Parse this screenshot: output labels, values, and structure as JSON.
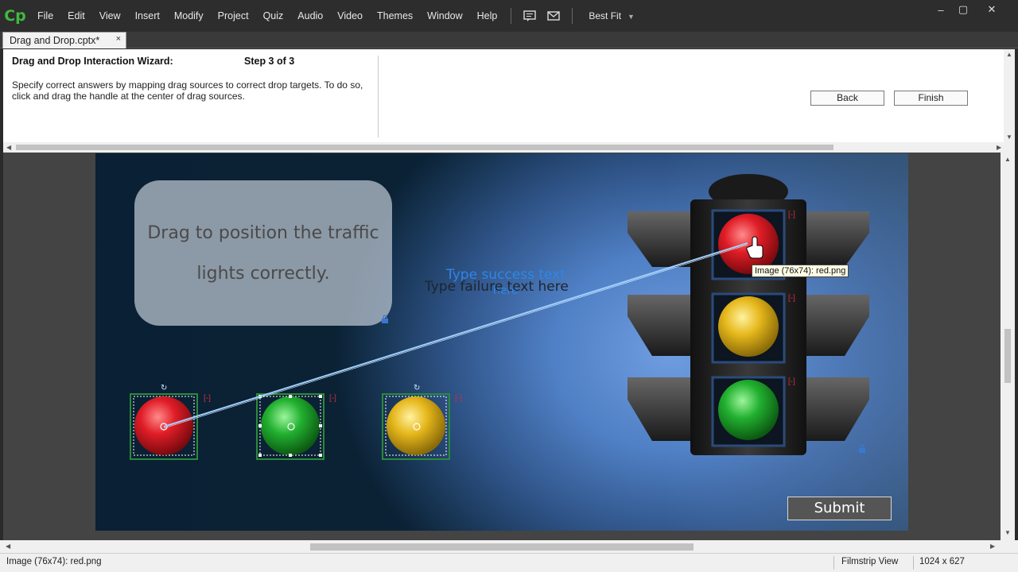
{
  "app": {
    "logo": "Cp"
  },
  "menu": [
    "File",
    "Edit",
    "View",
    "Insert",
    "Modify",
    "Project",
    "Quiz",
    "Audio",
    "Video",
    "Themes",
    "Window",
    "Help"
  ],
  "toolbar": {
    "zoom_label": "Best Fit"
  },
  "window_controls": {
    "minimize": "–",
    "restore": "▢",
    "close": "✕"
  },
  "tab": {
    "label": "Drag and Drop.cptx*",
    "close": "×"
  },
  "wizard": {
    "title": "Drag and Drop Interaction Wizard:",
    "step": "Step  3  of 3",
    "description": "Specify correct answers by mapping drag sources to correct drop targets. To do so, click and drag the handle at the center of drag sources.",
    "back_label": "Back",
    "finish_label": "Finish"
  },
  "stage": {
    "caption": "Drag to position the traffic lights correctly.",
    "success_text": "Type success text",
    "success_text_2": "here",
    "failure_text": "Type failure text here",
    "submit_label": "Submit",
    "tooltip": "Image (76x74): red.png",
    "drag_sources": [
      {
        "name": "red",
        "color": "#d81e26"
      },
      {
        "name": "green",
        "color": "#22b030"
      },
      {
        "name": "yellow",
        "color": "#e6b81c"
      }
    ],
    "lights": [
      {
        "name": "red",
        "color": "#e01d27"
      },
      {
        "name": "yellow",
        "color": "#f0c020"
      },
      {
        "name": "green",
        "color": "#20b030"
      }
    ],
    "connector_color": "#9ed0ff"
  },
  "status": {
    "selection": "Image (76x74): red.png",
    "view": "Filmstrip View",
    "size": "1024 x 627"
  }
}
